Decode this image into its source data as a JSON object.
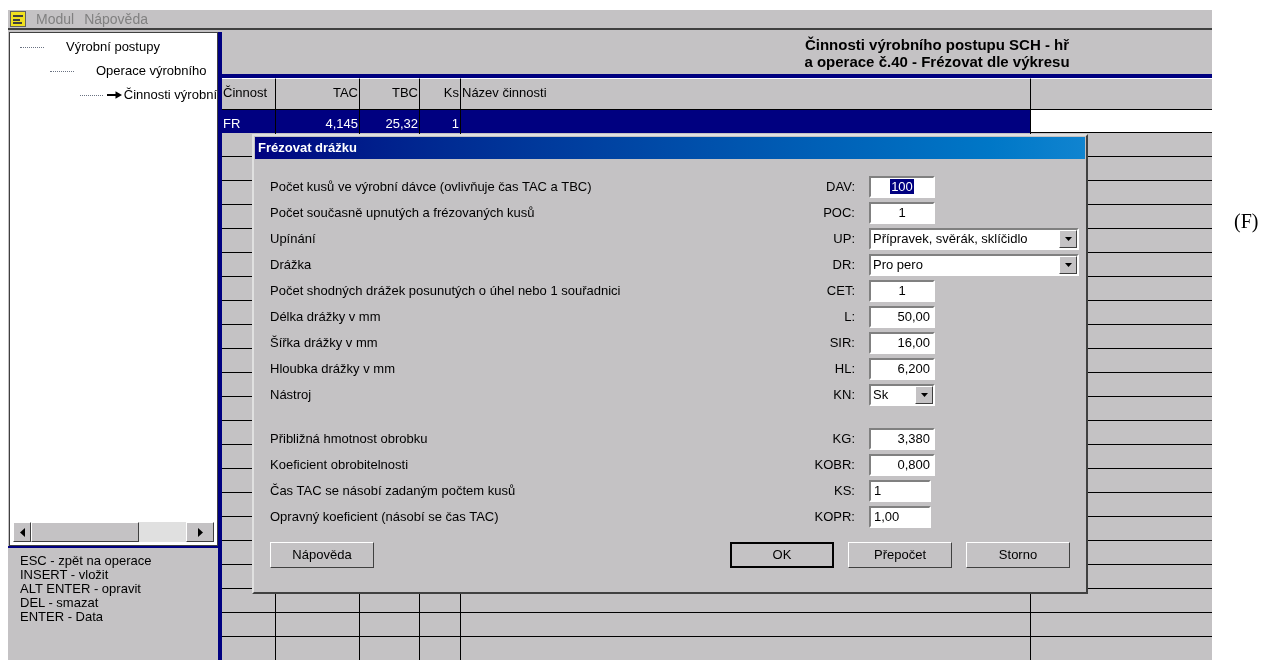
{
  "menu": [
    "Modul",
    "Nápověda"
  ],
  "tree": [
    {
      "label": "Výrobní postupy",
      "selected": false,
      "children": [
        {
          "label": "Operace výrobního",
          "selected": false,
          "children": [
            {
              "label": "Činnosti výrobní",
              "selected": true
            }
          ]
        }
      ]
    }
  ],
  "shortcuts": [
    "ESC - zpět na operace",
    "INSERT - vložit",
    "ALT ENTER - opravit",
    "DEL - smazat",
    "ENTER - Data"
  ],
  "header": [
    "Činnosti výrobního postupu SCH - hř",
    "a operace č.40 - Frézovat dle výkresu"
  ],
  "table": {
    "columns": [
      "Činnost",
      "TAC",
      "TBC",
      "Ks",
      "Název činnosti"
    ],
    "rows": [
      {
        "cells": [
          "FR",
          "4,145",
          "25,32",
          "1",
          ""
        ],
        "selected": true
      }
    ]
  },
  "dialog": {
    "title": "Frézovat drážku",
    "groups": [
      [
        {
          "label": "Počet kusů ve výrobní dávce (ovlivňuje čas TAC a TBC)",
          "code": "DAV:",
          "kind": "count",
          "value": "100",
          "selected": true
        },
        {
          "label": "Počet současně upnutých a frézovaných kusů",
          "code": "POC:",
          "kind": "count",
          "value": "1",
          "selected": false
        },
        {
          "label": "Upínání",
          "code": "UP:",
          "kind": "select",
          "value": "Přípravek, svěrák, sklíčidlo",
          "selected": false
        },
        {
          "label": "Drážka",
          "code": "DR:",
          "kind": "select",
          "value": "Pro pero",
          "selected": false
        },
        {
          "label": "Počet shodných drážek posunutých o úhel nebo 1 souřadnici",
          "code": "CET:",
          "kind": "count",
          "value": "1",
          "selected": false
        },
        {
          "label": "Délka drážky v mm",
          "code": "L:",
          "kind": "number",
          "value": "50,00",
          "selected": false
        },
        {
          "label": "Šířka drážky v mm",
          "code": "SIR:",
          "kind": "number",
          "value": "16,00",
          "selected": false
        },
        {
          "label": "Hloubka drážky v mm",
          "code": "HL:",
          "kind": "number",
          "value": "6,200",
          "selected": false
        },
        {
          "label": "Nástroj",
          "code": "KN:",
          "kind": "combo",
          "value": "Sk",
          "selected": false
        }
      ],
      [
        {
          "label": "Přibližná hmotnost obrobku",
          "code": "KG:",
          "kind": "number",
          "value": "3,380",
          "selected": false
        },
        {
          "label": "Koeficient obrobitelnosti",
          "code": "KOBR:",
          "kind": "number",
          "value": "0,800",
          "selected": false
        },
        {
          "label": "Čas TAC se násobí zadaným počtem kusů",
          "code": "KS:",
          "kind": "text",
          "value": "1",
          "selected": false
        },
        {
          "label": "Opravný koeficient (násobí se čas TAC)",
          "code": "KOPR:",
          "kind": "text",
          "value": "1,00",
          "selected": false
        }
      ]
    ],
    "left_buttons": [
      "Nápověda"
    ],
    "right_buttons": [
      {
        "label": "OK",
        "default": true
      },
      {
        "label": "Přepočet",
        "default": false
      },
      {
        "label": "Storno",
        "default": false
      }
    ]
  },
  "figure_label": "(F)"
}
